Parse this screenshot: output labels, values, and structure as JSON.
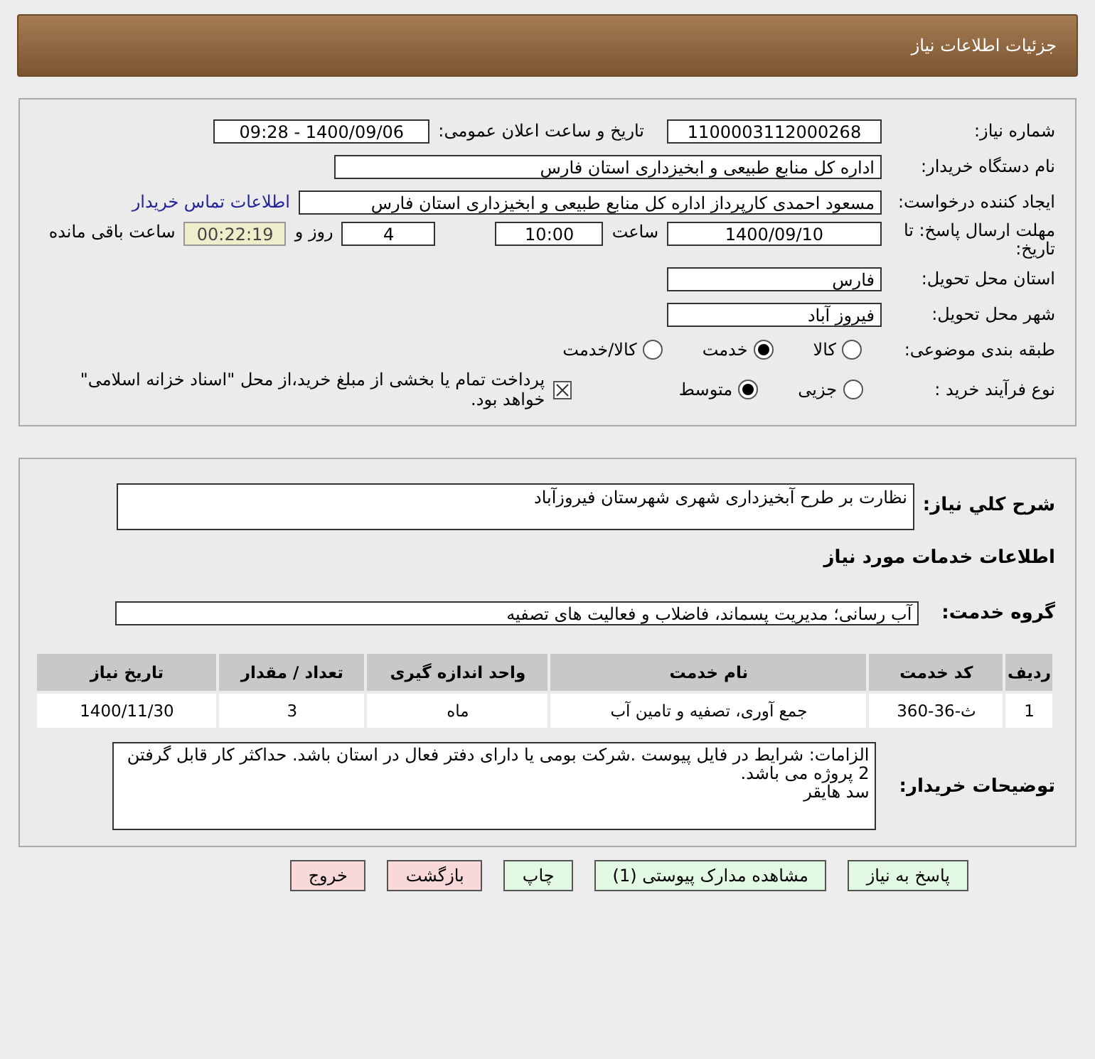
{
  "header": {
    "title": "جزئیات اطلاعات نیاز"
  },
  "need_number": {
    "label": "شماره نیاز:",
    "value": "1100003112000268"
  },
  "announce": {
    "label": "تاریخ و ساعت اعلان عمومی:",
    "value": "1400/09/06 - 09:28"
  },
  "buyer_org": {
    "label": "نام دستگاه خریدار:",
    "value": "اداره کل منابع طبیعی و ابخیزداری استان فارس"
  },
  "requester": {
    "label": "ایجاد کننده درخواست:",
    "value": "مسعود احمدی کارپرداز اداره کل منابع طبیعی و ابخیزداری استان فارس",
    "link": "اطلاعات تماس خریدار"
  },
  "deadline": {
    "label": "مهلت ارسال پاسخ: تا تاریخ:",
    "date": "1400/09/10",
    "time_label": "ساعت",
    "time": "10:00",
    "days": "4",
    "days_label": "روز و",
    "remaining": "00:22:19",
    "remaining_label": "ساعت باقی مانده"
  },
  "province": {
    "label": "استان محل تحویل:",
    "value": "فارس"
  },
  "city": {
    "label": "شهر محل تحویل:",
    "value": "فیروز آباد"
  },
  "category": {
    "label": "طبقه بندی موضوعی:",
    "options": [
      {
        "label": "کالا",
        "selected": false
      },
      {
        "label": "خدمت",
        "selected": true
      },
      {
        "label": "کالا/خدمت",
        "selected": false
      }
    ]
  },
  "process": {
    "label": "نوع فرآیند خرید :",
    "options": [
      {
        "label": "جزیی",
        "selected": false
      },
      {
        "label": "متوسط",
        "selected": true
      }
    ],
    "payment": {
      "checked": true,
      "label": "پرداخت تمام یا بخشی از مبلغ خرید،از محل \"اسناد خزانه اسلامی\" خواهد بود."
    }
  },
  "description": {
    "label": "شرح کلي نياز:",
    "value": "نظارت بر طرح آبخیزداری شهری شهرستان  فیروزآباد"
  },
  "services_heading": "اطلاعات خدمات مورد نیاز",
  "service_group": {
    "label": "گروه خدمت:",
    "value": "آب رسانی؛ مدیریت پسماند، فاضلاب و فعالیت های تصفیه"
  },
  "table": {
    "columns": [
      "ردیف",
      "کد خدمت",
      "نام خدمت",
      "واحد اندازه گیری",
      "تعداد / مقدار",
      "تاریخ نیاز"
    ],
    "rows": [
      [
        "1",
        "ث-36-360",
        "جمع آوری، تصفیه و تامین آب",
        "ماه",
        "3",
        "1400/11/30"
      ]
    ]
  },
  "buyer_notes": {
    "label": "توضیحات خریدار:",
    "lines": [
      "الزامات: شرایط در فایل پیوست .شرکت بومی یا دارای دفتر فعال در استان باشد. حداکثر کار قابل گرفتن 2 پروژه می باشد.",
      "سد هایقر"
    ]
  },
  "buttons": [
    {
      "label": "پاسخ به نیاز",
      "kind": "primary"
    },
    {
      "label": "مشاهده مدارک پیوستی (1)",
      "kind": "primary"
    },
    {
      "label": "چاپ",
      "kind": "primary"
    },
    {
      "label": "بازگشت",
      "kind": "danger"
    },
    {
      "label": "خروج",
      "kind": "danger"
    }
  ]
}
